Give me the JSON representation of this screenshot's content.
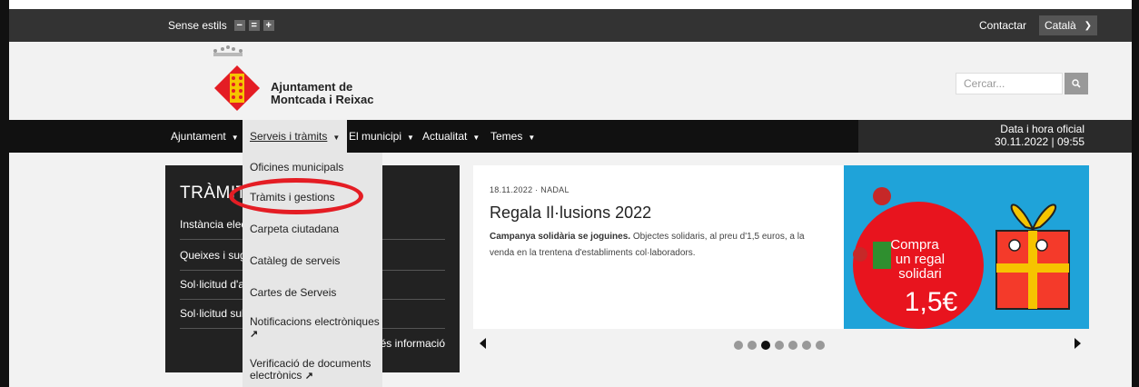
{
  "topbar": {
    "styles_label": "Sense estils",
    "btn_minus": "−",
    "btn_equal": "=",
    "btn_plus": "+",
    "contact": "Contactar",
    "language": "Català"
  },
  "header": {
    "logo_line1": "Ajuntament de",
    "logo_line2": "Montcada i Reixac",
    "search_placeholder": "Cercar...",
    "brand_colors": {
      "red": "#e41d24",
      "yellow": "#f6c400"
    }
  },
  "nav": {
    "items": [
      {
        "label": "Ajuntament"
      },
      {
        "label": "Serveis i tràmits"
      },
      {
        "label": "El municipi"
      },
      {
        "label": "Actualitat"
      },
      {
        "label": "Temes"
      }
    ],
    "datetime_label": "Data i hora oficial",
    "datetime_value": "30.11.2022 | 09:55"
  },
  "dropdown": {
    "items": [
      {
        "label": "Oficines municipals"
      },
      {
        "label": "Tràmits i gestions"
      },
      {
        "label": "Carpeta ciutadana"
      },
      {
        "label": "Catàleg de serveis"
      },
      {
        "label": "Cartes de Serveis"
      },
      {
        "label": "Notificacions electròniques"
      },
      {
        "label_line1": "Verificació de documents",
        "label_line2": "electrònics"
      }
    ]
  },
  "tramits": {
    "title": "TRÀMIT",
    "rows": [
      "Instància elect",
      "Queixes i sugg",
      "Sol·licitud d'ac",
      "Sol·licitud subv"
    ],
    "more": "Més informació"
  },
  "carousel": {
    "meta": "18.11.2022 · NADAL",
    "title": "Regala Il·lusions 2022",
    "desc_bold": "Campanya solidària se joguines.",
    "desc_rest": " Objectes solidaris, al preu d'1,5 euros, a la venda en la trentena d'establiments col·laboradors.",
    "promo_line1": "Compra",
    "promo_line2": "un regal",
    "promo_line3": "solidari",
    "promo_price": "1,5€",
    "dots_total": 7,
    "dots_active_index": 2
  }
}
